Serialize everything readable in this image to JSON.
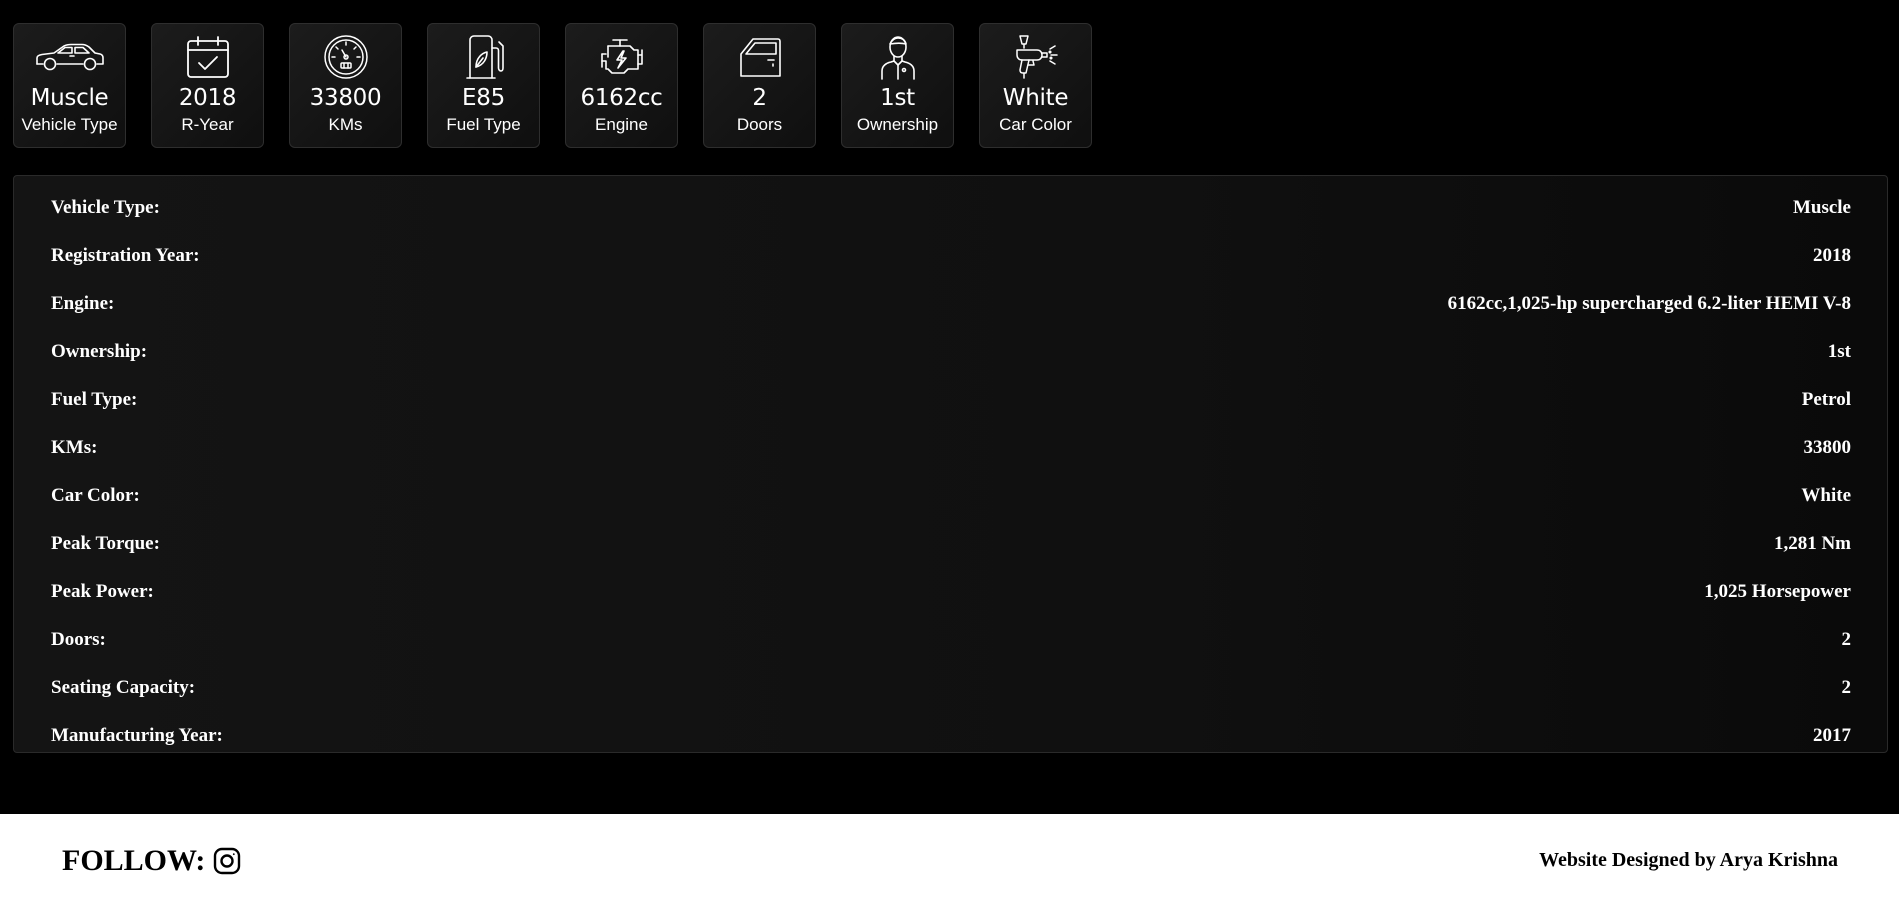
{
  "cards": [
    {
      "icon": "car-icon",
      "value": "Muscle",
      "label": "Vehicle Type"
    },
    {
      "icon": "calendar-check-icon",
      "value": "2018",
      "label": "R-Year"
    },
    {
      "icon": "speedometer-icon",
      "value": "33800",
      "label": "KMs"
    },
    {
      "icon": "fuel-pump-icon",
      "value": "E85",
      "label": "Fuel Type"
    },
    {
      "icon": "engine-icon",
      "value": "6162cc",
      "label": "Engine"
    },
    {
      "icon": "car-door-icon",
      "value": "2",
      "label": "Doors"
    },
    {
      "icon": "person-icon",
      "value": "1st",
      "label": "Ownership"
    },
    {
      "icon": "spray-gun-icon",
      "value": "White",
      "label": "Car Color"
    }
  ],
  "specs": [
    {
      "label": "Vehicle Type:",
      "value": "Muscle"
    },
    {
      "label": "Registration Year:",
      "value": "2018"
    },
    {
      "label": "Engine:",
      "value": "6162cc,1,025-hp supercharged 6.2-liter HEMI V-8"
    },
    {
      "label": "Ownership:",
      "value": "1st"
    },
    {
      "label": "Fuel Type:",
      "value": "Petrol"
    },
    {
      "label": "KMs:",
      "value": "33800"
    },
    {
      "label": "Car Color:",
      "value": "White"
    },
    {
      "label": "Peak Torque:",
      "value": "1,281 Nm"
    },
    {
      "label": "Peak Power:",
      "value": "1,025 Horsepower"
    },
    {
      "label": "Doors:",
      "value": "2"
    },
    {
      "label": "Seating Capacity:",
      "value": "2"
    },
    {
      "label": "Manufacturing Year:",
      "value": "2017"
    }
  ],
  "footer": {
    "follow_label": "FOLLOW:",
    "social_icon": "instagram-icon",
    "credit": "Website Designed by Arya Krishna"
  },
  "colors": {
    "page_background": "#000000",
    "footer_background": "#ffffff",
    "text": "#ffffff"
  }
}
